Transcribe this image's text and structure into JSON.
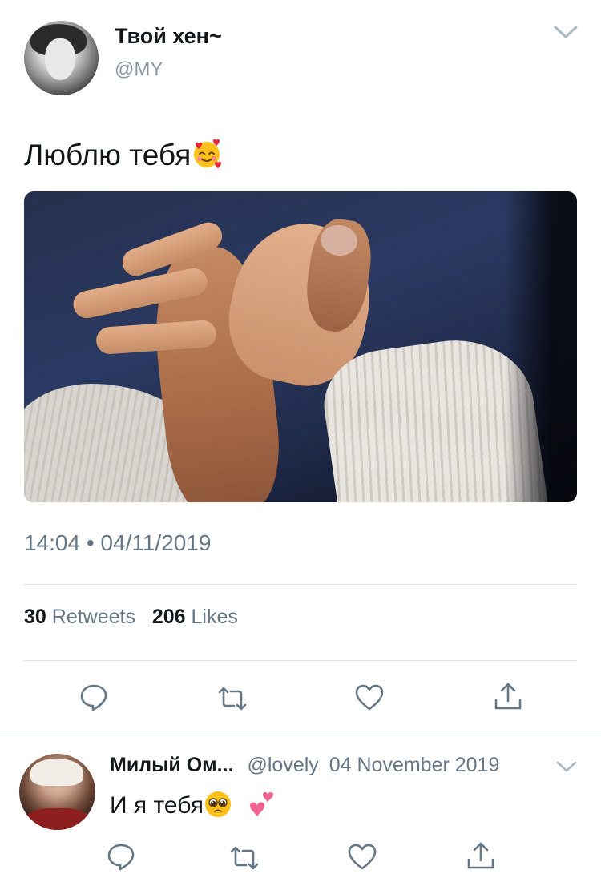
{
  "tweet": {
    "author_name": "Твой хен~",
    "author_handle": "@MY",
    "text": "Люблю тебя",
    "text_emoji": "smiling-face-with-hearts-emoji",
    "timestamp": "14:04 • 04/11/2019",
    "retweets_count": "30",
    "retweets_label": "Retweets",
    "likes_count": "206",
    "likes_label": "Likes",
    "actions": [
      "reply-icon",
      "retweet-icon",
      "like-icon",
      "share-icon"
    ]
  },
  "reply": {
    "author_name": "Милый Ом...",
    "author_handle": "@lovely",
    "date": "04 November 2019",
    "text": "И я тебя",
    "emojis": [
      "pleading-face-emoji",
      "two-hearts-emoji"
    ],
    "actions": [
      "reply-icon",
      "retweet-icon",
      "like-icon",
      "share-icon"
    ]
  },
  "colors": {
    "text_primary": "#14171a",
    "text_secondary": "#657786",
    "handle": "#8899a6",
    "divider": "#dbe2e8"
  }
}
